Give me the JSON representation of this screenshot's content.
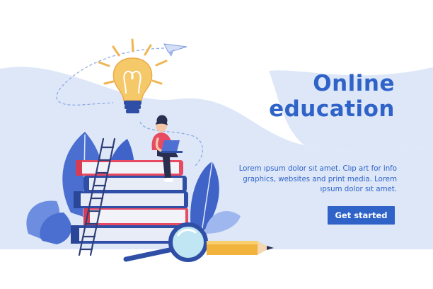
{
  "hero": {
    "title_line1": "Online",
    "title_line2": "education",
    "description": "Lorem ıpsum dolor sıt amet. Clıp art for info graphics, websites and print media. Lorem ıpsum dolor sıt amet.",
    "cta_label": "Get started"
  },
  "colors": {
    "accent": "#2f63c8",
    "background_wave": "#dde7f8",
    "book_red": "#e84a62",
    "book_blue": "#2f4fa6",
    "bulb_yellow": "#f5c96a"
  }
}
